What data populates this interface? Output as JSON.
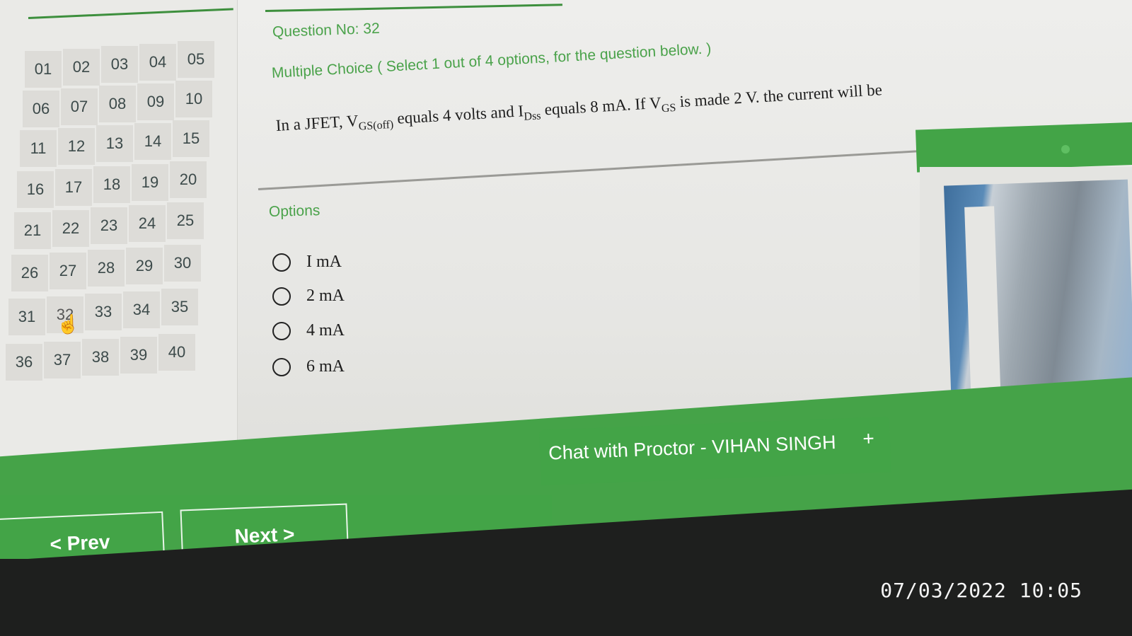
{
  "question": {
    "number_label": "Question No: 32",
    "type_label": "Multiple Choice ( Select 1 out of 4 options, for the question below. )",
    "text_parts": {
      "p1": "In a JFET, V",
      "s1": "GS(off)",
      "p2": " equals 4 volts and I",
      "s2": "Dss",
      "p3": " equals 8 mA. If V",
      "s3": "GS",
      "p4": " is made 2 V. the current will be"
    }
  },
  "options": {
    "heading": "Options",
    "items": [
      {
        "label": "I mA"
      },
      {
        "label": "2 mA"
      },
      {
        "label": "4 mA"
      },
      {
        "label": "6 mA"
      }
    ]
  },
  "palette": {
    "current": "32",
    "numbers": [
      "01",
      "02",
      "03",
      "04",
      "05",
      "06",
      "07",
      "08",
      "09",
      "10",
      "11",
      "12",
      "13",
      "14",
      "15",
      "16",
      "17",
      "18",
      "19",
      "20",
      "21",
      "22",
      "23",
      "24",
      "25",
      "26",
      "27",
      "28",
      "29",
      "30",
      "31",
      "32",
      "33",
      "34",
      "35",
      "36",
      "37",
      "38",
      "39",
      "40"
    ]
  },
  "chat": {
    "label": "Chat with Proctor - VIHAN SINGH",
    "plus": "+"
  },
  "nav": {
    "prev_label": "< Prev",
    "next_label": "Next >"
  },
  "overlay": {
    "timestamp": "07/03/2022 10:05"
  },
  "colors": {
    "accent_green": "#43a447",
    "text_green": "#4aa24a"
  }
}
